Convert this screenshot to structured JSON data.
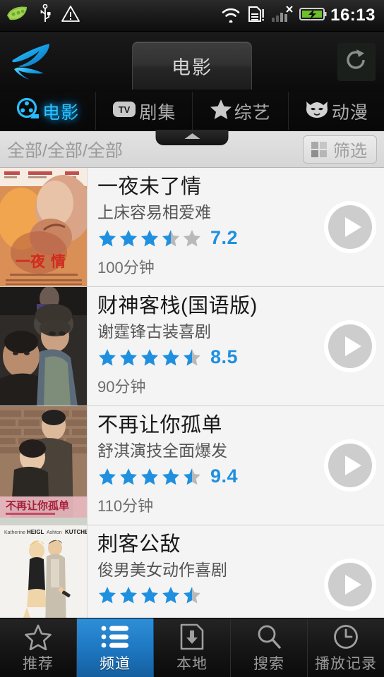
{
  "status_bar": {
    "time": "16:13",
    "left_icons": [
      "pea-pod-icon",
      "usb-icon",
      "warning-triangle-icon"
    ],
    "right_icons": [
      "wifi-icon",
      "sim-card-alert-icon",
      "signal-bars-icon",
      "battery-charging-icon"
    ]
  },
  "header": {
    "logo": "swallow-bird-logo",
    "title": "电影",
    "refresh_icon": "refresh-icon"
  },
  "category_tabs": [
    {
      "label": "电影",
      "icon": "film-reel-icon",
      "active": true
    },
    {
      "label": "剧集",
      "icon": "tv-icon",
      "active": false
    },
    {
      "label": "综艺",
      "icon": "star-icon",
      "active": false
    },
    {
      "label": "动漫",
      "icon": "devil-cat-face-icon",
      "active": false
    }
  ],
  "filter_bar": {
    "selection": "全部/全部/全部",
    "filter_label": "筛选",
    "filter_icon": "grid-icon",
    "collapse_icon": "chevron-up-icon"
  },
  "movies": [
    {
      "title": "一夜未了情",
      "subtitle": "上床容易相爱难",
      "score": "7.2",
      "stars": 3.5,
      "duration": "100分钟",
      "poster": "poster-romance-orange"
    },
    {
      "title": "财神客栈(国语版)",
      "subtitle": "谢霆锋古装喜剧",
      "score": "8.5",
      "stars": 4.5,
      "duration": "90分钟",
      "poster": "poster-costume-comedy-dark"
    },
    {
      "title": "不再让你孤单",
      "subtitle": "舒淇演技全面爆发",
      "score": "9.4",
      "stars": 4.5,
      "duration": "110分钟",
      "poster": "poster-couple-brick-wall"
    },
    {
      "title": "刺客公敌",
      "subtitle": "俊男美女动作喜剧",
      "score": "",
      "stars": 4.5,
      "duration": "",
      "poster": "poster-killers-white"
    }
  ],
  "bottom_nav": [
    {
      "label": "推荐",
      "icon": "star-outline-icon",
      "active": false
    },
    {
      "label": "频道",
      "icon": "list-icon",
      "active": true
    },
    {
      "label": "本地",
      "icon": "download-icon",
      "active": false
    },
    {
      "label": "搜索",
      "icon": "search-icon",
      "active": false
    },
    {
      "label": "播放记录",
      "icon": "clock-icon",
      "active": false
    }
  ],
  "colors": {
    "accent_blue": "#1f90e0",
    "tab_glow": "#2ec2ff",
    "nav_active": "#1f79c4"
  }
}
